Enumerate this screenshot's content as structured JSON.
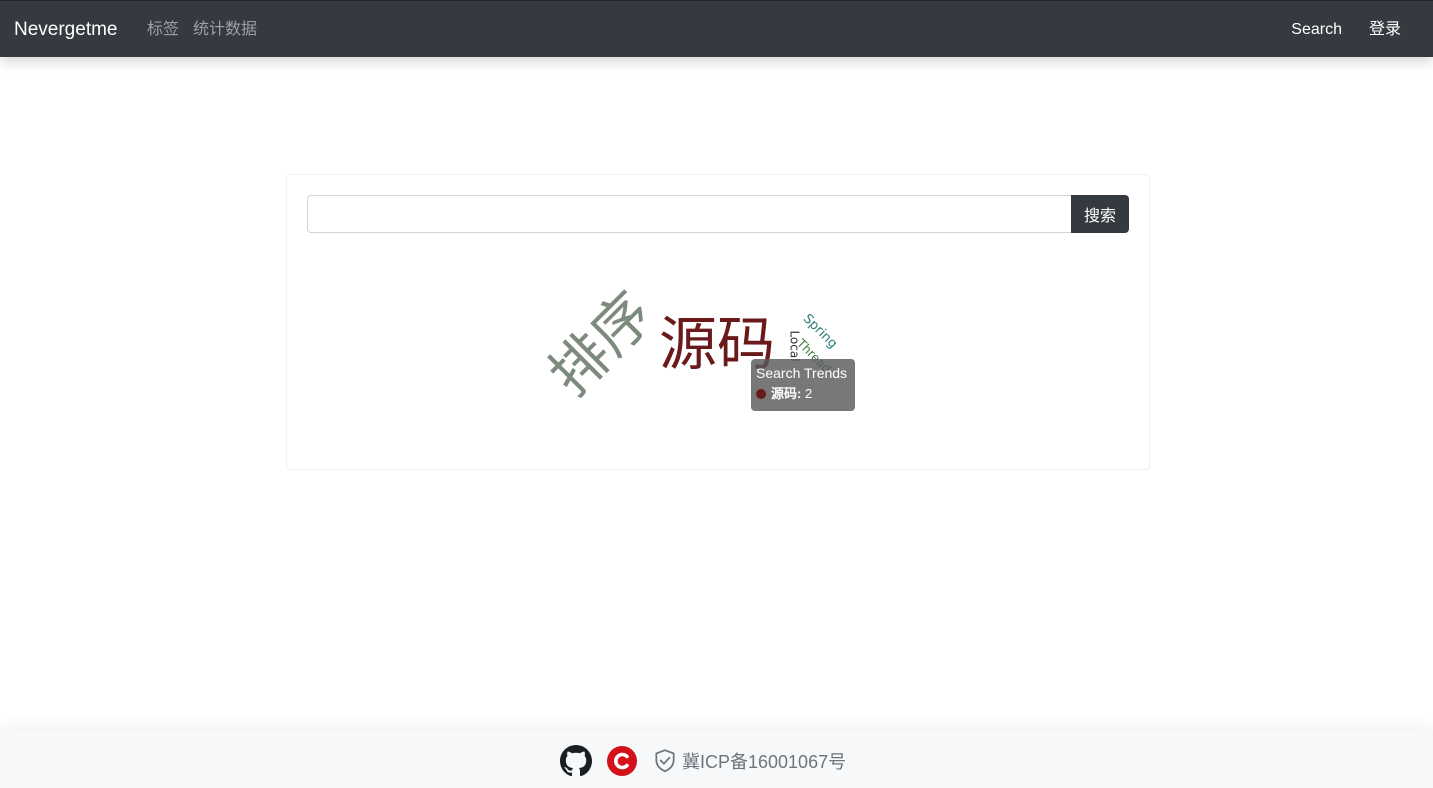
{
  "navbar": {
    "brand": "Nevergetme",
    "links": [
      "标签",
      "统计数据"
    ],
    "right_links": [
      "Search",
      "登录"
    ]
  },
  "search": {
    "value": "",
    "placeholder": "",
    "button_label": "搜索"
  },
  "word_cloud": {
    "words": [
      {
        "text": "排序",
        "color": "#7d8a7e"
      },
      {
        "text": "源码",
        "color": "#6b1a1c"
      },
      {
        "text": "Spring",
        "color": "#2e7c7a"
      },
      {
        "text": "Local",
        "color": "#333333"
      },
      {
        "text": "Thread",
        "color": "#3f7a3f"
      }
    ]
  },
  "tooltip": {
    "title": "Search Trends",
    "label": "源码",
    "value": "2",
    "dot_color": "#6b1a1c"
  },
  "footer": {
    "icp_text": "冀ICP备16001067号",
    "icons": [
      "github-icon",
      "csdn-icon",
      "shield-icon"
    ]
  }
}
